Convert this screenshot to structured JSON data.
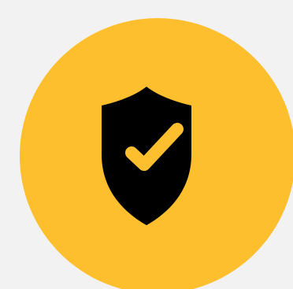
{
  "icon": {
    "name": "shield-check-icon",
    "check_name": "checkmark-icon"
  },
  "colors": {
    "background": "#f2f2f2",
    "circle": "#fdbf2d",
    "shield": "#000000",
    "check": "#fdbf2d"
  }
}
